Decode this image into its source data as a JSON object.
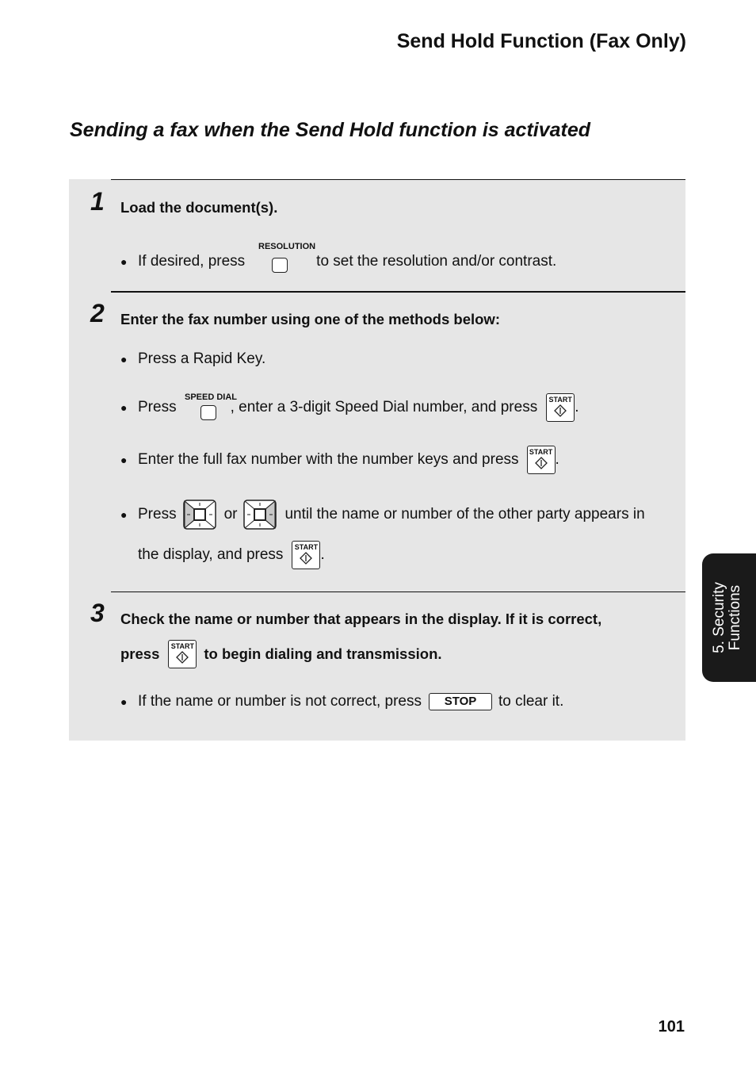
{
  "header": {
    "section_title": "Send Hold Function (Fax Only)",
    "subtitle": "Sending a fax when the Send Hold function is activated"
  },
  "steps": [
    {
      "number": "1",
      "heading": "Load the document(s).",
      "bullets": [
        {
          "pre": "If desired, press",
          "key_label": "RESOLUTION",
          "post": "to set the resolution and/or contrast."
        }
      ]
    },
    {
      "number": "2",
      "heading": "Enter the fax number using one of the methods below:",
      "bullets": [
        {
          "text": "Press a Rapid Key."
        },
        {
          "pre": "Press",
          "key_label": "SPEED DIAL",
          "mid": ", enter a 3-digit Speed Dial number, and press",
          "end": "."
        },
        {
          "pre": "Enter the full fax number with the number keys and press",
          "end": "."
        },
        {
          "pre": "Press",
          "or": "or",
          "post": "until the name or number of the other party appears in",
          "cont": "the display, and press",
          "end": "."
        }
      ]
    },
    {
      "number": "3",
      "heading_line1": "Check the name or number that appears in the display. If it is correct,",
      "heading_pre": "press",
      "heading_post": "to begin dialing and transmission.",
      "bullets": [
        {
          "pre": "If the name or number is not correct, press",
          "key_label": "STOP",
          "post": "to clear it."
        }
      ]
    }
  ],
  "keys": {
    "start_label": "START",
    "nav_left_icon": "left-arrow-key-icon",
    "nav_right_icon": "right-arrow-key-icon"
  },
  "side_tab": {
    "line1": "5. Security",
    "line2": "Functions"
  },
  "page_number": "101"
}
